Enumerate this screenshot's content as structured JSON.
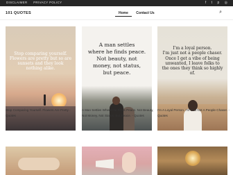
{
  "topbar": {
    "links": [
      "DISCLAIMER",
      "PRIVACY POLICY"
    ],
    "social": [
      "facebook-icon",
      "twitter-icon",
      "pinterest-icon",
      "instagram-icon"
    ]
  },
  "header": {
    "logo": "101 QUOTES",
    "nav": [
      "Home",
      "Contact Us"
    ]
  },
  "cards": [
    {
      "quote": "Stop comparing yourself.\nFlowers are pretty but so are\nsunsets and they look\nnothing alike.",
      "caption": "Stop Comparing Yourself. Flowers Are Pretty - Quotes"
    },
    {
      "quote": "A man settles\nwhere he finds peace.\nNot beauty, not\nmoney, not status,\nbut peace.",
      "caption": "A Man Settles Where He Finds Peace. Not Beauty, Not Money, Not Status, But Peace. - Quotes"
    },
    {
      "quote": "I'm a loyal person.\nI'm just not a people chaser.\nOnce I get a vibe of being\nunwanted, I leave folks to\nthe ones they think so highly of.",
      "caption": "I'm A Loyal Person. I'm Just Not A People Chaser. - Quotes"
    }
  ]
}
